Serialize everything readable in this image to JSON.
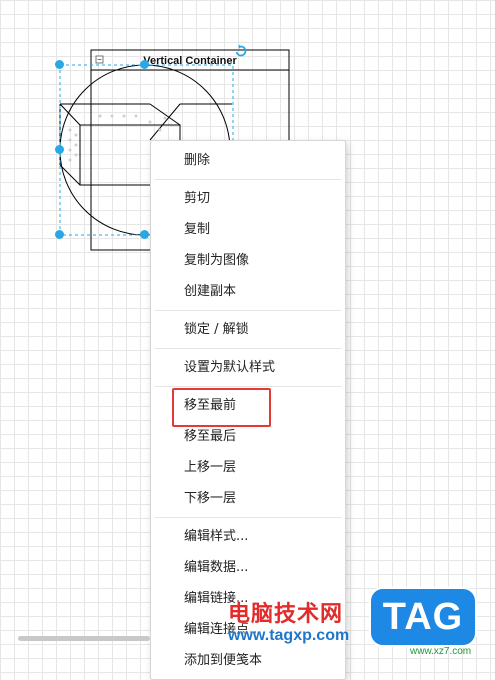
{
  "canvas": {
    "container_title": "Vertical Container"
  },
  "context_menu": {
    "groups": [
      [
        "删除"
      ],
      [
        "剪切",
        "复制",
        "复制为图像",
        "创建副本"
      ],
      [
        "锁定 / 解锁"
      ],
      [
        "设置为默认样式"
      ],
      [
        "移至最前",
        "移至最后",
        "上移一层",
        "下移一层"
      ],
      [
        "编辑样式...",
        "编辑数据...",
        "编辑链接...",
        "编辑连接点...",
        "添加到便笺本"
      ]
    ],
    "highlighted_item": "移至最前"
  },
  "watermark": {
    "site_name": "电脑技术网",
    "url": "www.tagxp.com",
    "badge": "TAG",
    "domain": "www.xz7.com"
  },
  "colors": {
    "selection": "#29a8e6",
    "highlight_border": "#e53935",
    "watermark_red": "#e32b2b",
    "watermark_blue": "#1e88e5"
  },
  "icons": {
    "container_collapse": "minus-box-icon",
    "rotate": "rotate-icon"
  }
}
